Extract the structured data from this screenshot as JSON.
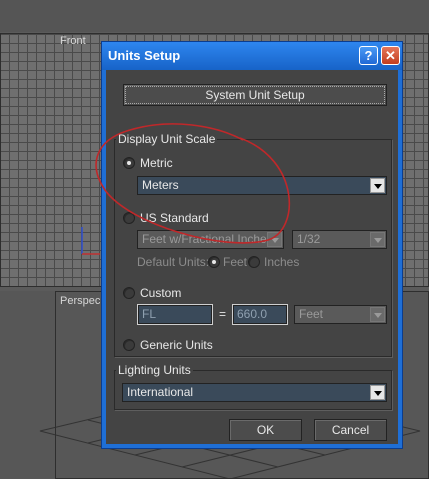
{
  "viewports": {
    "front_label": "Front",
    "perspective_label": "Perspec"
  },
  "dialog": {
    "title": "Units Setup",
    "help_glyph": "?",
    "close_glyph": "✕",
    "system_unit_setup_label": "System Unit Setup",
    "display_unit_scale": {
      "group_title": "Display Unit Scale",
      "metric_label": "Metric",
      "metric_selected": true,
      "metric_value": "Meters",
      "us_standard_label": "US Standard",
      "us_standard_value": "Feet w/Fractional Inches",
      "us_fraction_value": "1/32",
      "default_units_label": "Default Units:",
      "default_feet_label": "Feet",
      "default_inches_label": "Inches",
      "custom_label": "Custom",
      "custom_name_value": "FL",
      "custom_equals": "=",
      "custom_amount_value": "660.0",
      "custom_unit_value": "Feet",
      "generic_units_label": "Generic Units"
    },
    "lighting_units": {
      "group_title": "Lighting Units",
      "value": "International"
    },
    "ok_label": "OK",
    "cancel_label": "Cancel"
  },
  "colors": {
    "title_bar": "#1f6fd6",
    "dialog_client": "#444444",
    "annotation": "#c0282a"
  },
  "icons": [
    "help-icon",
    "close-icon",
    "chevron-down-icon"
  ]
}
